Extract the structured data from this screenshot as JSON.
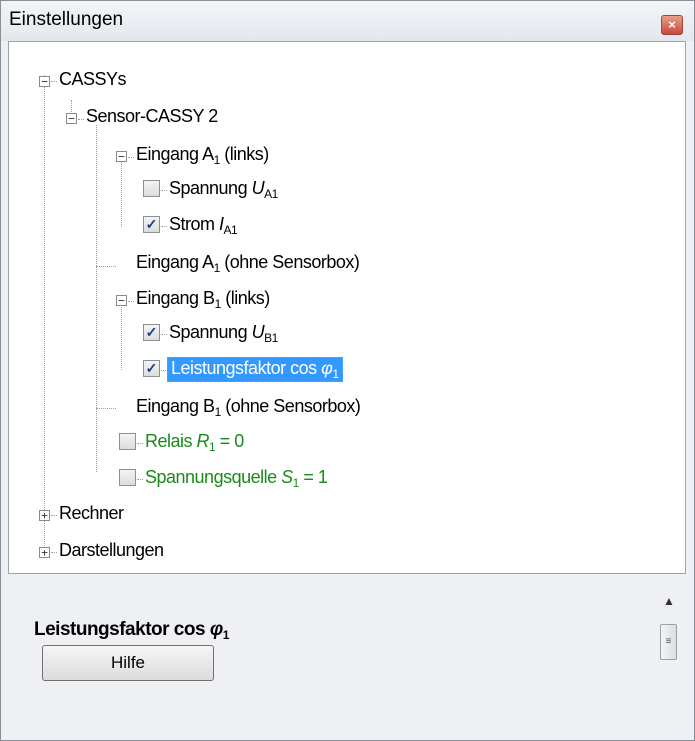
{
  "window": {
    "title": "Einstellungen",
    "close_glyph": "×"
  },
  "tree": {
    "root_cassys": "CASSYs",
    "sensor_cassy": "Sensor-CASSY 2",
    "eingang_a": {
      "pre": "Eingang A",
      "sub": "1",
      "post": " (links)"
    },
    "spannung_ua": {
      "pre": "Spannung ",
      "var": "U",
      "sub": "A1",
      "checked": false
    },
    "strom_ia": {
      "pre": "Strom ",
      "var": "I",
      "sub": "A1",
      "checked": true
    },
    "eingang_a_ohne": {
      "pre": "Eingang A",
      "sub": "1",
      "post": " (ohne Sensorbox)"
    },
    "eingang_b": {
      "pre": "Eingang B",
      "sub": "1",
      "post": " (links)"
    },
    "spannung_ub": {
      "pre": "Spannung ",
      "var": "U",
      "sub": "B1",
      "checked": true
    },
    "leistungsfaktor": {
      "pre": "Leistungsfaktor cos ",
      "var": "φ",
      "sub": "1",
      "checked": true
    },
    "eingang_b_ohne": {
      "pre": "Eingang B",
      "sub": "1",
      "post": " (ohne Sensorbox)"
    },
    "relais": {
      "pre": "Relais ",
      "var": "R",
      "sub": "1",
      "post": " = 0",
      "checked": false,
      "color": "#1a8a1a"
    },
    "spannungsquelle": {
      "pre": "Spannungsquelle ",
      "var": "S",
      "sub": "1",
      "post": " = 1",
      "checked": false,
      "color": "#1a8a1a"
    },
    "rechner": "Rechner",
    "darstellungen": "Darstellungen",
    "expander_open": "−",
    "expander_closed": "+",
    "check_glyph": "✓"
  },
  "description": {
    "title_pre": "Leistungsfaktor cos ",
    "title_var": "φ",
    "title_sub": "1",
    "help_button": "Hilfe"
  },
  "colors": {
    "selection": "#3399ff",
    "green_text": "#1a8a1a"
  }
}
